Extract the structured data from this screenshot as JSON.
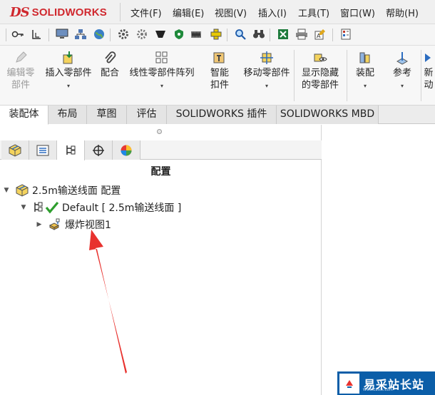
{
  "app": {
    "logo_text": "SOLIDWORKS",
    "logo_mark": "DS"
  },
  "menu": {
    "items": [
      "文件(F)",
      "编辑(E)",
      "视图(V)",
      "插入(I)",
      "工具(T)",
      "窗口(W)",
      "帮助(H)"
    ]
  },
  "command_manager": {
    "edit_component": "编辑零部件",
    "insert_components": "插入零部件",
    "mate": "配合",
    "linear_pattern": "线性零部件阵列",
    "smart_fasteners": "智能扣件",
    "move_component": "移动零部件",
    "show_hidden": "显示隐藏的零部件",
    "assembly_features": "装配",
    "reference_geometry": "参考",
    "new_motion": "新动"
  },
  "tabs": [
    "装配体",
    "布局",
    "草图",
    "评估",
    "SOLIDWORKS 插件",
    "SOLIDWORKS MBD"
  ],
  "panel": {
    "title": "配置",
    "tree": {
      "root_label": "2.5m输送线面 配置",
      "config_label": "Default [ 2.5m输送线面 ]",
      "exploded_view_label": "爆炸视图1"
    }
  },
  "watermark": {
    "text": "易采站长站",
    "url": "Www.Easck.Com"
  },
  "colors": {
    "brand_red": "#d0282e",
    "arrow_red": "#e8322e",
    "check_green": "#2e9e2e",
    "watermark_blue": "#0b5ea8"
  }
}
